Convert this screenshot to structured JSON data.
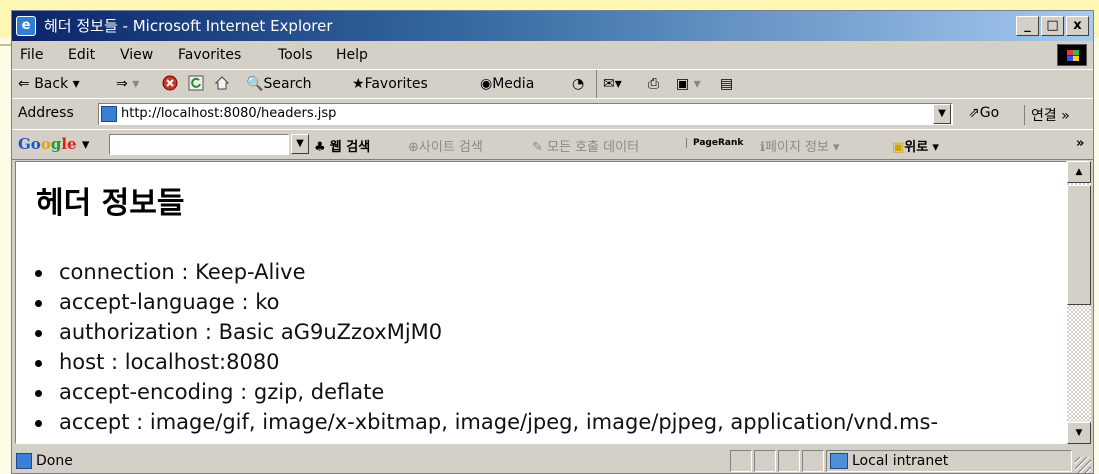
{
  "window": {
    "title": "헤더 정보들 - Microsoft Internet Explorer",
    "app_icon": "e",
    "controls": {
      "minimize": "_",
      "maximize": "□",
      "close": "x"
    }
  },
  "menu": [
    "File",
    "Edit",
    "View",
    "Favorites",
    "Tools",
    "Help"
  ],
  "toolbar": {
    "back": "Back",
    "search": "Search",
    "favorites": "Favorites",
    "media": "Media"
  },
  "address": {
    "label": "Address",
    "url": "http://localhost:8080/headers.jsp",
    "go": "Go",
    "links": "연결 »"
  },
  "google_bar": {
    "brand": [
      "Go",
      "o",
      "g",
      "le"
    ],
    "search_web": "웹 검색",
    "search_site": "사이트 검색",
    "page_info_search": "모든 호출 데이터",
    "pagerank": "PageRank",
    "page_info": "페이지 정보",
    "up": "위로",
    "more": "»"
  },
  "page": {
    "heading": "헤더 정보들",
    "headers": [
      "connection : Keep-Alive",
      "accept-language : ko",
      "authorization : Basic aG9uZzoxMjM0",
      "host : localhost:8080",
      "accept-encoding : gzip, deflate",
      "accept : image/gif, image/x-xbitmap, image/jpeg, image/pjpeg, application/vnd.ms-"
    ]
  },
  "status": {
    "text": "Done",
    "zone": "Local intranet"
  },
  "colors": {
    "title_gradient_start": "#0a246a",
    "title_gradient_end": "#a6caf0",
    "chrome": "#d4d0c8",
    "slide_background": "#fdfbe6"
  }
}
